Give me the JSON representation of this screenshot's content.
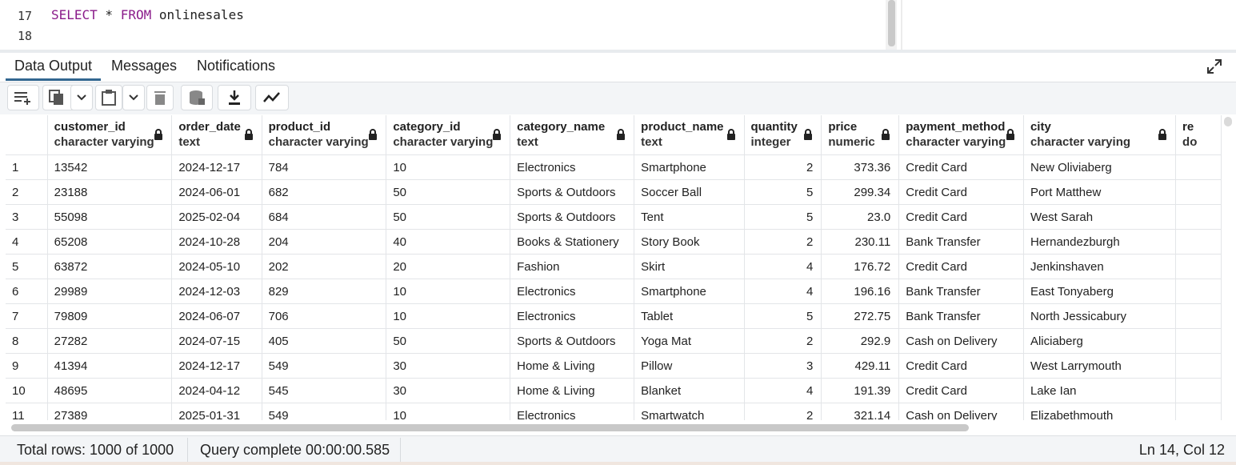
{
  "editor": {
    "line_numbers": [
      "17",
      "18"
    ],
    "code_keyword1": "SELECT",
    "code_star": " * ",
    "code_keyword2": "FROM",
    "code_table": " onlinesales"
  },
  "tabs": [
    {
      "label": "Data Output",
      "active": true
    },
    {
      "label": "Messages",
      "active": false
    },
    {
      "label": "Notifications",
      "active": false
    }
  ],
  "toolbar_icons": [
    "add-row-icon",
    "copy-icon",
    "chevron-down-icon",
    "paste-icon",
    "chevron-down-icon",
    "delete-icon",
    "save-data-icon",
    "download-icon",
    "graph-icon"
  ],
  "columns": [
    {
      "name": "customer_id",
      "type": "character varying"
    },
    {
      "name": "order_date",
      "type": "text"
    },
    {
      "name": "product_id",
      "type": "character varying"
    },
    {
      "name": "category_id",
      "type": "character varying"
    },
    {
      "name": "category_name",
      "type": "text"
    },
    {
      "name": "product_name",
      "type": "text"
    },
    {
      "name": "quantity",
      "type": "integer"
    },
    {
      "name": "price",
      "type": "numeric"
    },
    {
      "name": "payment_method",
      "type": "character varying"
    },
    {
      "name": "city",
      "type": "character varying"
    },
    {
      "name": "re",
      "type": "do"
    }
  ],
  "rows": [
    [
      "1",
      "13542",
      "2024-12-17",
      "784",
      "10",
      "Electronics",
      "Smartphone",
      "2",
      "373.36",
      "Credit Card",
      "New Oliviaberg"
    ],
    [
      "2",
      "23188",
      "2024-06-01",
      "682",
      "50",
      "Sports & Outdoors",
      "Soccer Ball",
      "5",
      "299.34",
      "Credit Card",
      "Port Matthew"
    ],
    [
      "3",
      "55098",
      "2025-02-04",
      "684",
      "50",
      "Sports & Outdoors",
      "Tent",
      "5",
      "23.0",
      "Credit Card",
      "West Sarah"
    ],
    [
      "4",
      "65208",
      "2024-10-28",
      "204",
      "40",
      "Books & Stationery",
      "Story Book",
      "2",
      "230.11",
      "Bank Transfer",
      "Hernandezburgh"
    ],
    [
      "5",
      "63872",
      "2024-05-10",
      "202",
      "20",
      "Fashion",
      "Skirt",
      "4",
      "176.72",
      "Credit Card",
      "Jenkinshaven"
    ],
    [
      "6",
      "29989",
      "2024-12-03",
      "829",
      "10",
      "Electronics",
      "Smartphone",
      "4",
      "196.16",
      "Bank Transfer",
      "East Tonyaberg"
    ],
    [
      "7",
      "79809",
      "2024-06-07",
      "706",
      "10",
      "Electronics",
      "Tablet",
      "5",
      "272.75",
      "Bank Transfer",
      "North Jessicabury"
    ],
    [
      "8",
      "27282",
      "2024-07-15",
      "405",
      "50",
      "Sports & Outdoors",
      "Yoga Mat",
      "2",
      "292.9",
      "Cash on Delivery",
      "Aliciaberg"
    ],
    [
      "9",
      "41394",
      "2024-12-17",
      "549",
      "30",
      "Home & Living",
      "Pillow",
      "3",
      "429.11",
      "Credit Card",
      "West Larrymouth"
    ],
    [
      "10",
      "48695",
      "2024-04-12",
      "545",
      "30",
      "Home & Living",
      "Blanket",
      "4",
      "191.39",
      "Credit Card",
      "Lake Ian"
    ],
    [
      "11",
      "27389",
      "2025-01-31",
      "549",
      "10",
      "Electronics",
      "Smartwatch",
      "2",
      "321.14",
      "Cash on Delivery",
      "Elizabethmouth"
    ]
  ],
  "status": {
    "total_rows": "Total rows: 1000 of 1000",
    "query": "Query complete 00:00:00.585",
    "position": "Ln 14, Col 12"
  },
  "colors": {
    "accent": "#326690",
    "keyword": "#8a1b8a"
  }
}
